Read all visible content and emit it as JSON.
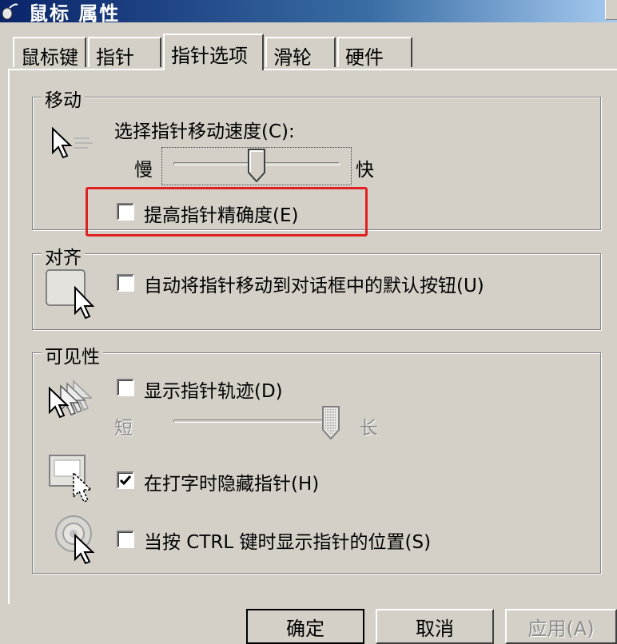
{
  "window": {
    "title": "鼠标 属性"
  },
  "tabs": [
    {
      "label": "鼠标键",
      "active": false
    },
    {
      "label": "指针",
      "active": false
    },
    {
      "label": "指针选项",
      "active": true
    },
    {
      "label": "滑轮",
      "active": false
    },
    {
      "label": "硬件",
      "active": false
    }
  ],
  "motion": {
    "title": "移动",
    "speed_label": "选择指针移动速度(C):",
    "slow_label": "慢",
    "fast_label": "快",
    "speed_level": 0.5,
    "enhance_precision": {
      "label": "提高指针精确度(E)",
      "checked": false
    }
  },
  "snap_to": {
    "title": "对齐",
    "auto_move": {
      "label": "自动将指针移动到对话框中的默认按钮(U)",
      "checked": false
    }
  },
  "visibility": {
    "title": "可见性",
    "trails": {
      "label": "显示指针轨迹(D)",
      "checked": false
    },
    "short_label": "短",
    "long_label": "长",
    "trail_length": 1.0,
    "hide_typing": {
      "label": "在打字时隐藏指针(H)",
      "checked": true
    },
    "show_location": {
      "label": "当按 CTRL 键时显示指针的位置(S)",
      "checked": false
    }
  },
  "buttons": {
    "ok": "确定",
    "cancel": "取消",
    "apply": "应用(A)"
  },
  "colors": {
    "highlight": "#e02020",
    "face": "#d4d0c8",
    "titlebar": "#0a246a"
  }
}
